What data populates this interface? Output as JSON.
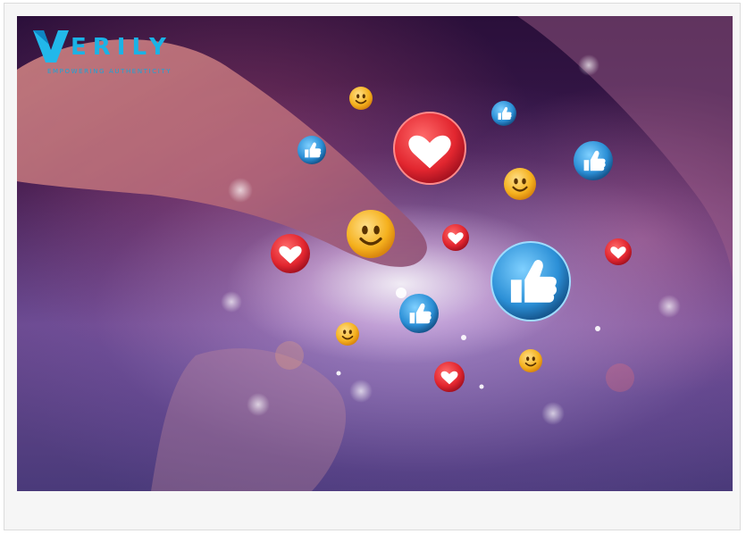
{
  "logo": {
    "wordmark": "ERILY",
    "tagline": "EMPOWERING AUTHENTICITY"
  },
  "colors": {
    "brand": "#1ab3e6",
    "heart": "#e8323c",
    "thumb": "#2e8fd8",
    "smiley": "#f6b422"
  },
  "icons": [
    "heart-icon",
    "thumbs-up-icon",
    "smiley-icon"
  ]
}
